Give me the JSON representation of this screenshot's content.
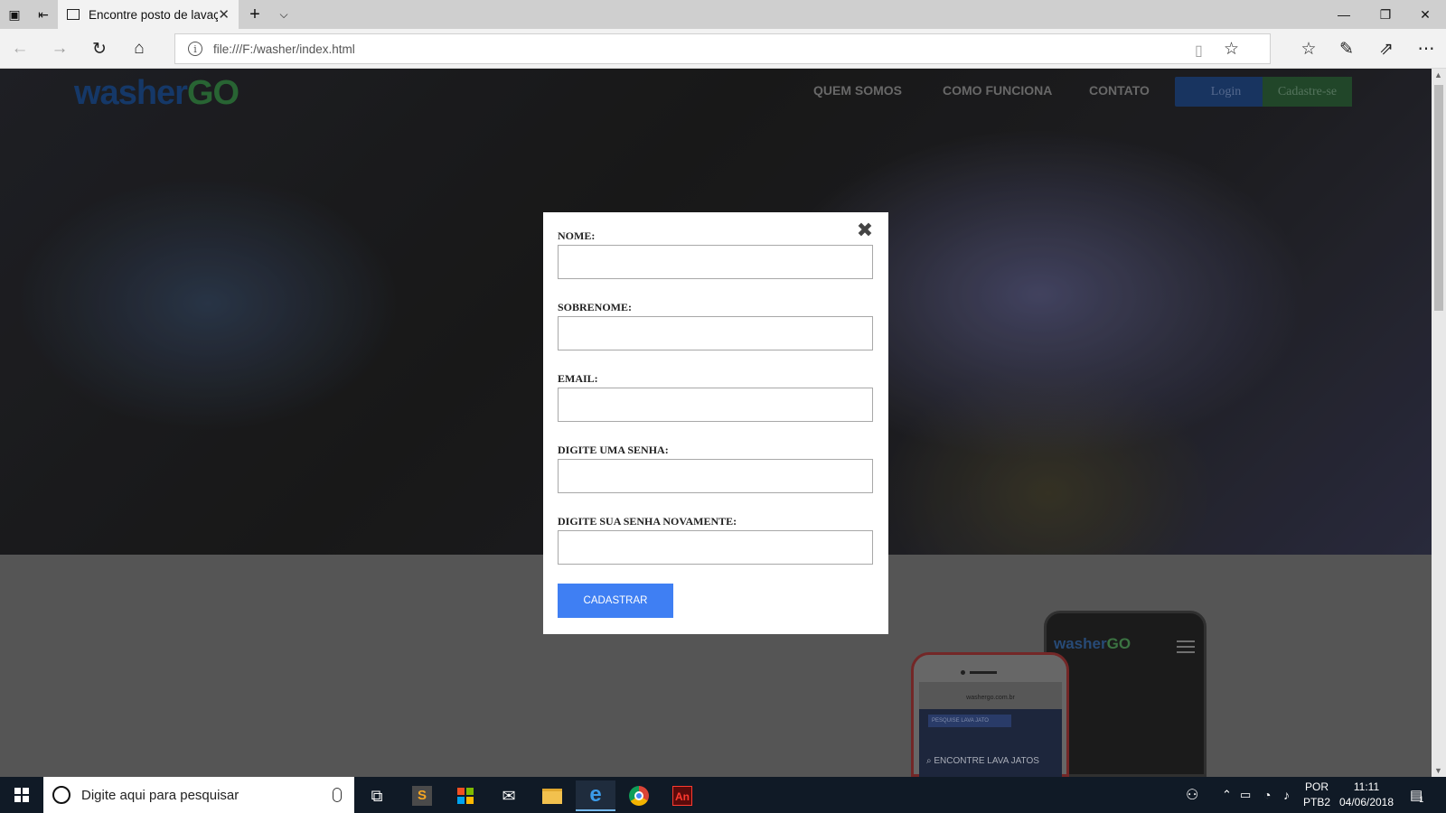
{
  "browser": {
    "tab_title": "Encontre posto de lavaç",
    "url": "file:///F:/washer/index.html",
    "icons": [
      "tab-set-aside-icon",
      "tab-restore-icon",
      "page-icon",
      "tab-close-icon",
      "new-tab-icon",
      "tab-list-icon",
      "back-icon",
      "forward-icon",
      "refresh-icon",
      "home-icon",
      "info-icon",
      "reading-view-icon",
      "favorite-star-icon",
      "favorites-hub-icon",
      "pen-icon",
      "share-icon",
      "more-icon"
    ]
  },
  "site": {
    "logo_part1": "washer",
    "logo_part2": "GO",
    "nav": [
      "QUEM SOMOS",
      "COMO FUNCIONA",
      "CONTATO"
    ],
    "login_label": "Login",
    "signup_label": "Cadastre-se",
    "brand_colors": {
      "blue": "#1a3766",
      "green": "#234a2c"
    }
  },
  "modal": {
    "close_icon": "close-x-icon",
    "fields": [
      {
        "label": "NOME:",
        "value": ""
      },
      {
        "label": "SOBRENOME:",
        "value": ""
      },
      {
        "label": "EMAIL:",
        "value": ""
      },
      {
        "label": "DIGITE UMA SENHA:",
        "value": ""
      },
      {
        "label": "DIGITE SUA SENHA NOVAMENTE:",
        "value": ""
      }
    ],
    "submit_label": "CADASTRAR",
    "submit_color": "#3f7ff3"
  },
  "phone_mock": {
    "logo_part1": "washer",
    "logo_part2": "GO",
    "url": "washergo.com.br",
    "search_placeholder": "PESQUISE LAVA JATO",
    "cta": "ENCONTRE LAVA JATOS"
  },
  "taskbar": {
    "search_placeholder": "Digite aqui para pesquisar",
    "lang_line1": "POR",
    "lang_line2": "PTB2",
    "time": "11:11",
    "date": "04/06/2018",
    "notifications": "1"
  }
}
